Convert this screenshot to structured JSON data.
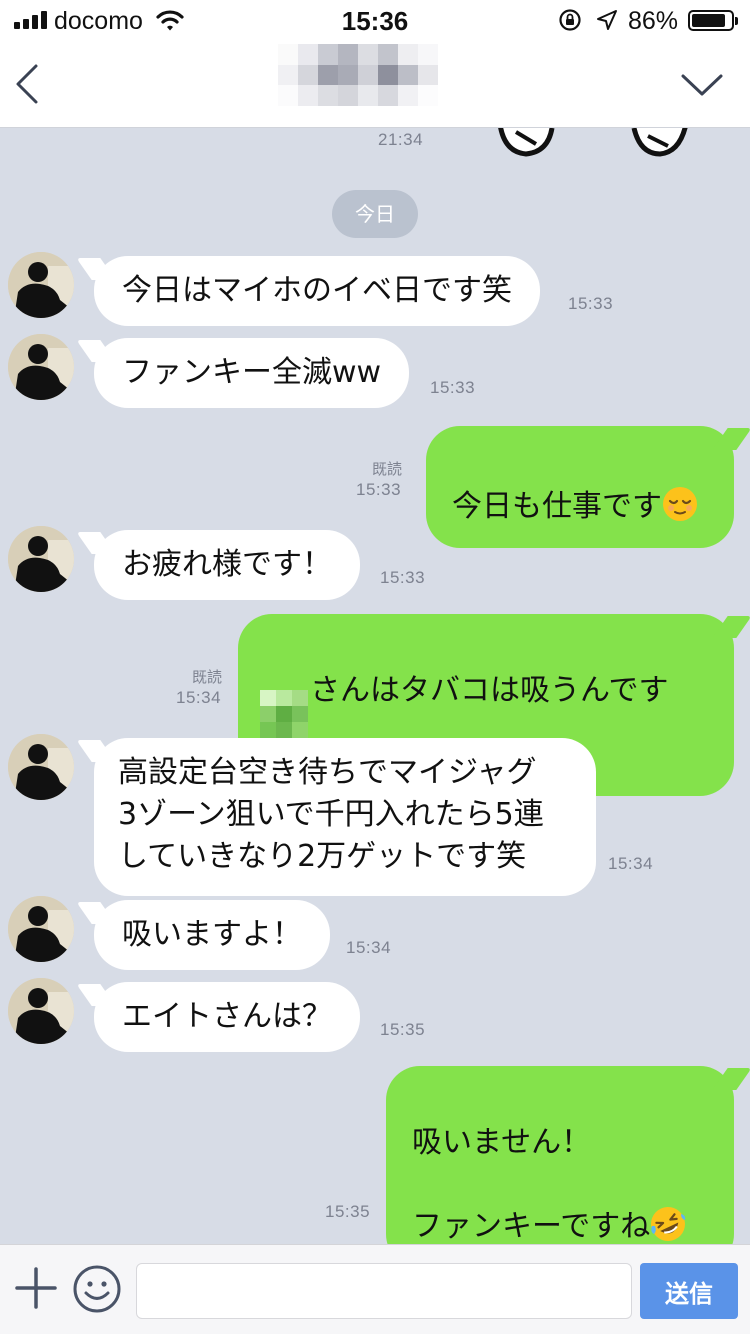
{
  "status_bar": {
    "carrier": "docomo",
    "time": "15:36",
    "battery_percent": "86%",
    "battery_level": 0.86,
    "icons": [
      "signal-icon",
      "wifi-icon",
      "orientation-lock-icon",
      "location-arrow-icon",
      "battery-icon"
    ]
  },
  "nav": {
    "back_icon": "chevron-left-icon",
    "menu_icon": "chevron-down-icon"
  },
  "chat": {
    "previous_time": "21:34",
    "date_label": "今日",
    "messages": [
      {
        "direction": "in",
        "text": "今日はマイホのイベ日です笑",
        "time": "15:33"
      },
      {
        "direction": "in",
        "text": "ファンキー全滅ww",
        "time": "15:33"
      },
      {
        "direction": "out",
        "text": "今日も仕事です",
        "emoji": "relieved-face-emoji",
        "read": "既読",
        "time": "15:33"
      },
      {
        "direction": "in",
        "text": "お疲れ様です！",
        "time": "15:33"
      },
      {
        "direction": "out",
        "text": "さんはタバコは吸うんです\nか？",
        "read": "既読",
        "time": "15:34"
      },
      {
        "direction": "in",
        "text": "高設定台空き待ちでマイジャグ\n3ゾーン狙いで千円入れたら5連\nしていきなり2万ゲットです笑",
        "time": "15:34"
      },
      {
        "direction": "in",
        "text": "吸いますよ！",
        "time": "15:34"
      },
      {
        "direction": "in",
        "text": "エイトさんは？",
        "time": "15:35"
      },
      {
        "direction": "out",
        "text": "吸いません！\n\nファンキーですね",
        "emoji": "rolling-laughing-emoji",
        "time": "15:35"
      }
    ]
  },
  "input_bar": {
    "placeholder": "",
    "send_label": "送信"
  },
  "colors": {
    "background": "#d7dce6",
    "outgoing_bubble": "#84e24b",
    "incoming_bubble": "#ffffff",
    "send_button": "#5a93e8"
  }
}
